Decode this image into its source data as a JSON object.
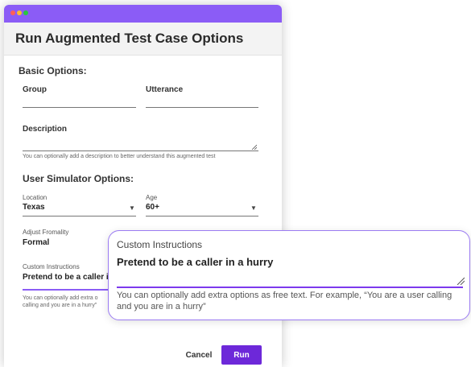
{
  "dialog": {
    "title": "Run Augmented Test Case Options"
  },
  "basic": {
    "title": "Basic Options:",
    "group_label": "Group",
    "utterance_label": "Utterance",
    "description_label": "Description",
    "description_helper": "You can optionally add a description to better understand this augmented test"
  },
  "simulator": {
    "title": "User Simulator Options:",
    "location_label": "Location",
    "location_value": "Texas",
    "age_label": "Age",
    "age_value": "60+",
    "formality_label": "Adjust Fromality",
    "formality_value": "Formal",
    "custom_label": "Custom Instructions",
    "custom_value": "Pretend to be a caller in a",
    "custom_helper_line1": "You can optionally add extra o",
    "custom_helper_line2": "calling and you are in a hurry\""
  },
  "buttons": {
    "cancel": "Cancel",
    "run": "Run"
  },
  "callout": {
    "label": "Custom Instructions",
    "value": "Pretend to be a caller in a hurry",
    "helper": "You can optionally add extra options as free text. For example, “You are a user calling and you are in a hurry”"
  },
  "colors": {
    "accent": "#8b5cf6",
    "run_button": "#6d28d9"
  }
}
